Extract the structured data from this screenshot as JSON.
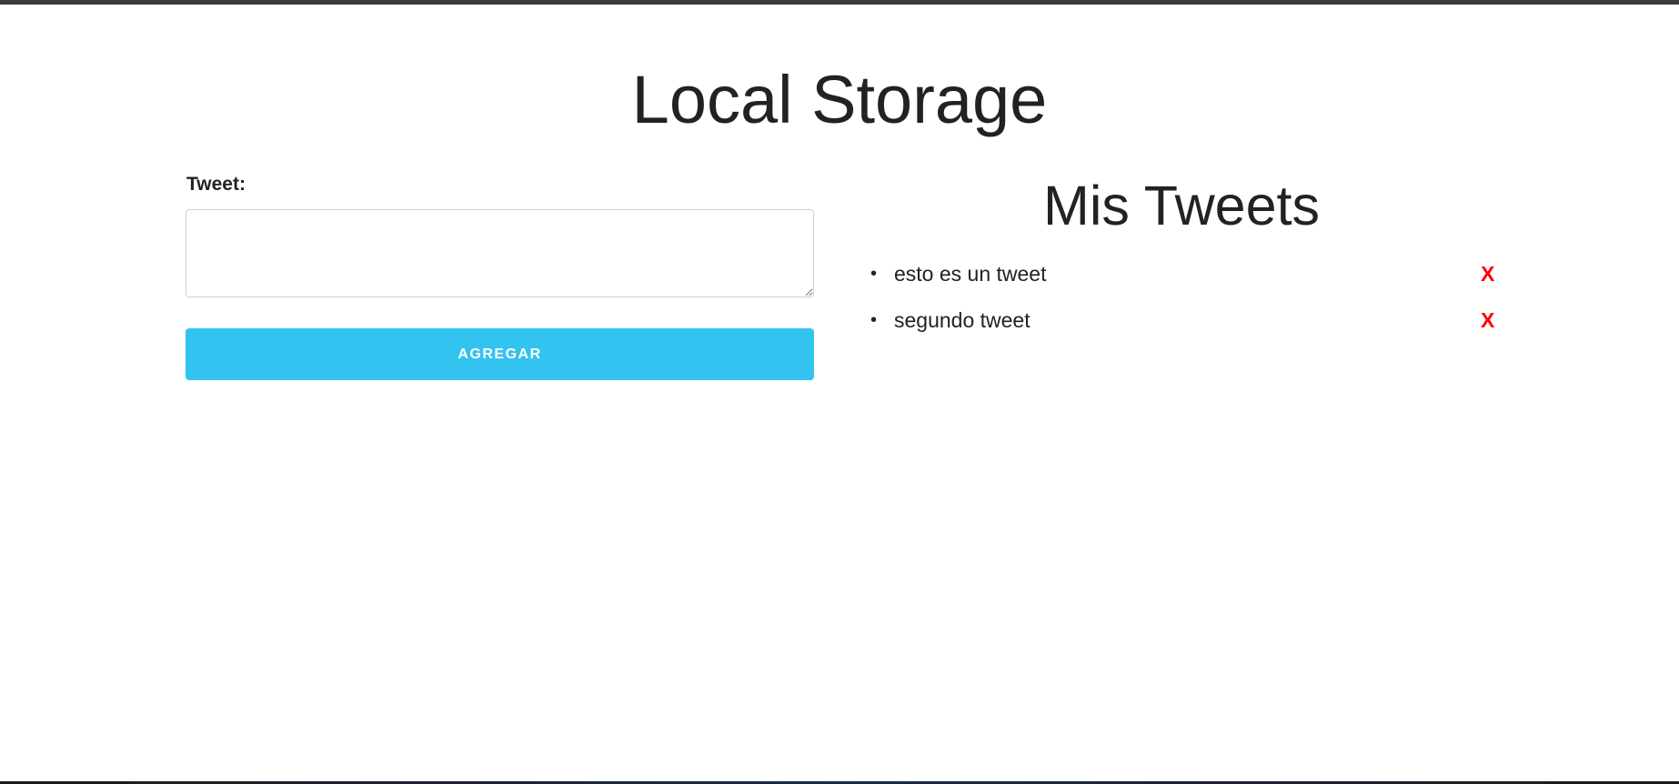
{
  "page": {
    "title": "Local Storage"
  },
  "form": {
    "label": "Tweet:",
    "textarea_value": "",
    "button_label": "Agregar"
  },
  "tweets": {
    "heading": "Mis Tweets",
    "items": [
      {
        "text": "esto es un tweet",
        "delete_label": "X"
      },
      {
        "text": "segundo tweet",
        "delete_label": "X"
      }
    ]
  },
  "colors": {
    "button_bg": "#33c3f0",
    "delete_color": "#ff0000",
    "text": "#222222"
  }
}
